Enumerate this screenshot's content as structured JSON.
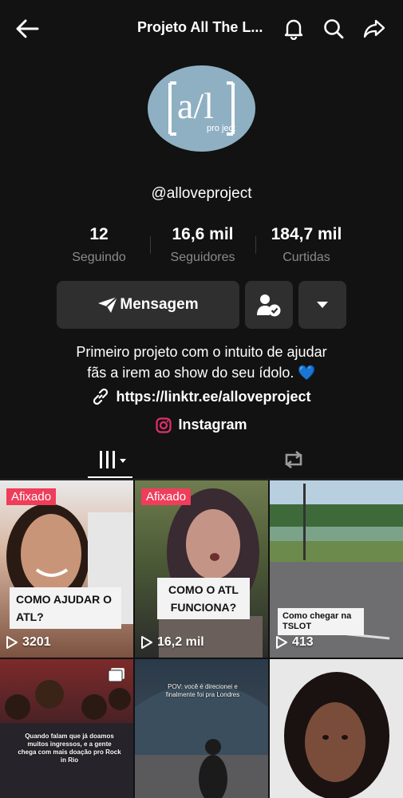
{
  "header": {
    "title": "Projeto All The L...",
    "back_icon": "back-arrow-icon",
    "bell_icon": "bell-icon",
    "search_icon": "search-icon",
    "share_icon": "share-icon"
  },
  "profile": {
    "avatar_text": "a/l",
    "avatar_sub": "pro ject",
    "handle": "@alloveproject",
    "stats": [
      {
        "value": "12",
        "label": "Seguindo"
      },
      {
        "value": "16,6 mil",
        "label": "Seguidores"
      },
      {
        "value": "184,7 mil",
        "label": "Curtidas"
      }
    ],
    "message_label": "Mensagem",
    "bio_line1": "Primeiro projeto com o intuito de ajudar",
    "bio_line2": "fãs a irem ao show do seu ídolo. 💙",
    "link": "https://linktr.ee/alloveproject",
    "instagram_label": "Instagram"
  },
  "videos": [
    {
      "pinned": "Afixado",
      "caption": "COMO AJUDAR O ATL?",
      "views": "3201"
    },
    {
      "pinned": "Afixado",
      "caption": "COMO O ATL FUNCIONA?",
      "views": "16,2 mil"
    },
    {
      "pinned": "",
      "caption": "Como chegar na TSLOT",
      "views": "413"
    },
    {
      "pinned": "",
      "caption": "Quando falam que já doamos muitos ingressos, e a gente chega com mais doação pro Rock in Rio",
      "views": ""
    },
    {
      "pinned": "",
      "caption": "POV: você é direcionei e finalmente foi pra Londres",
      "views": ""
    },
    {
      "pinned": "",
      "caption": "",
      "views": ""
    }
  ],
  "colors": {
    "background": "#121212",
    "button": "#2f2f2f",
    "pinned": "#ef3d5a",
    "heart": "#2a8de0",
    "instagram": "#e1306c"
  }
}
